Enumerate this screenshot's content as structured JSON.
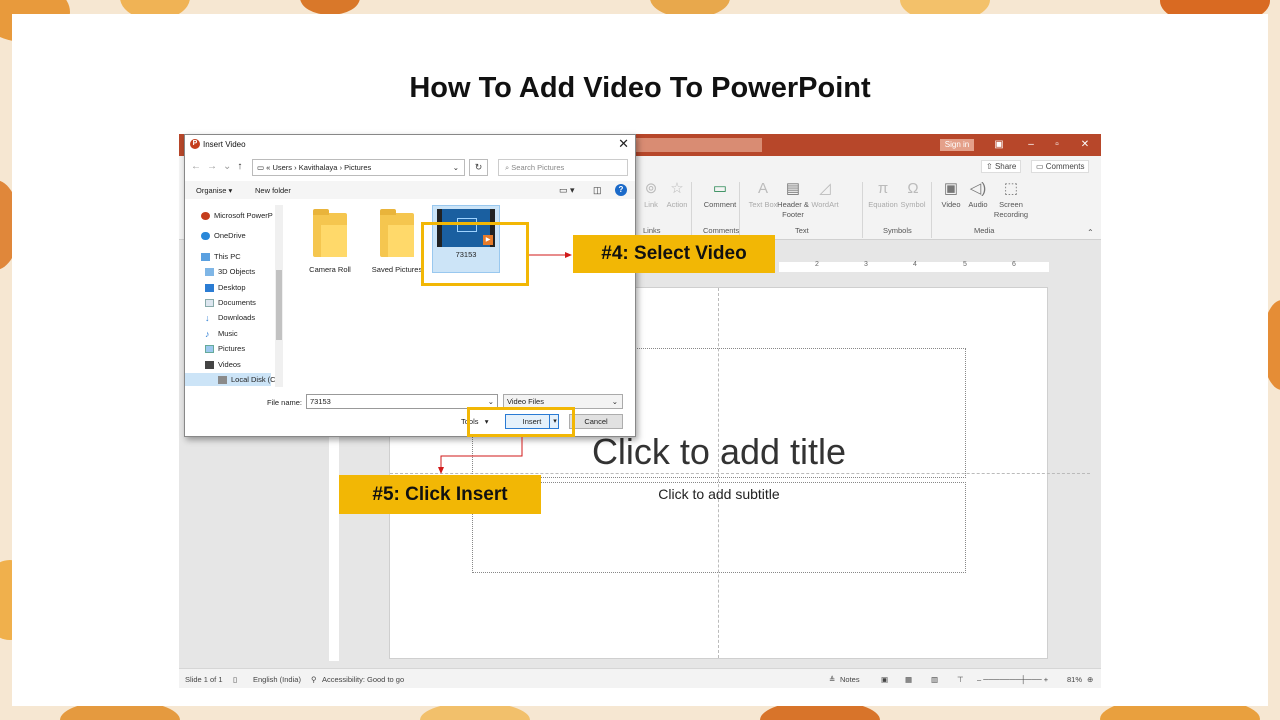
{
  "page": {
    "title": "How To Add Video To PowerPoint"
  },
  "colors": {
    "accent": "#f2b705",
    "ppt_brand": "#b7472a",
    "arrow": "#d11a1a"
  },
  "powerpoint": {
    "signin": "Sign in",
    "share": "Share",
    "comments": "Comments",
    "ribbon": {
      "buttons": [
        {
          "label": "Link",
          "icon": "link-icon"
        },
        {
          "label": "Action",
          "icon": "action-icon"
        },
        {
          "label": "Comment",
          "icon": "comment-icon"
        },
        {
          "label": "Text Box",
          "icon": "text-box-icon"
        },
        {
          "label": "Header & Footer",
          "icon": "header-footer-icon"
        },
        {
          "label": "WordArt",
          "icon": "wordart-icon"
        },
        {
          "label": "Equation",
          "icon": "equation-icon"
        },
        {
          "label": "Symbol",
          "icon": "symbol-icon"
        },
        {
          "label": "Video",
          "icon": "video-icon"
        },
        {
          "label": "Audio",
          "icon": "audio-icon"
        },
        {
          "label": "Screen Recording",
          "icon": "screen-recording-icon"
        }
      ],
      "groups": [
        "Links",
        "Comments",
        "Text",
        "Symbols",
        "Media"
      ]
    },
    "ruler_ticks": [
      "2",
      "3",
      "4",
      "5",
      "6"
    ],
    "slide": {
      "title_placeholder": "Click to add title",
      "subtitle_placeholder": "Click to add subtitle"
    },
    "status": {
      "slide": "Slide 1 of 1",
      "language": "English (India)",
      "accessibility": "Accessibility: Good to go",
      "notes": "Notes",
      "zoom": "81%"
    }
  },
  "dialog": {
    "title": "Insert Video",
    "breadcrumb": [
      "Users",
      "Kavithalaya",
      "Pictures"
    ],
    "search_placeholder": "Search Pictures",
    "toolbar": {
      "organise": "Organise ▾",
      "new_folder": "New folder"
    },
    "nav_items": [
      {
        "label": "Microsoft PowerP",
        "icon": "powerpoint-icon"
      },
      {
        "label": "OneDrive",
        "icon": "onedrive-icon"
      },
      {
        "label": "This PC",
        "icon": "pc-icon"
      },
      {
        "label": "3D Objects",
        "icon": "3d-objects-icon"
      },
      {
        "label": "Desktop",
        "icon": "desktop-icon"
      },
      {
        "label": "Documents",
        "icon": "documents-icon"
      },
      {
        "label": "Downloads",
        "icon": "downloads-icon"
      },
      {
        "label": "Music",
        "icon": "music-icon"
      },
      {
        "label": "Pictures",
        "icon": "pictures-icon"
      },
      {
        "label": "Videos",
        "icon": "videos-icon"
      },
      {
        "label": "Local Disk (C:)",
        "icon": "disk-icon"
      }
    ],
    "files": [
      {
        "name": "Camera Roll",
        "type": "folder"
      },
      {
        "name": "Saved Pictures",
        "type": "folder"
      },
      {
        "name": "73153",
        "type": "video"
      }
    ],
    "file_name_label": "File name:",
    "file_name_value": "73153",
    "file_type": "Video Files",
    "tools": "Tools",
    "insert": "Insert",
    "cancel": "Cancel"
  },
  "callouts": {
    "step4": "#4: Select Video",
    "step5": "#5: Click Insert"
  }
}
